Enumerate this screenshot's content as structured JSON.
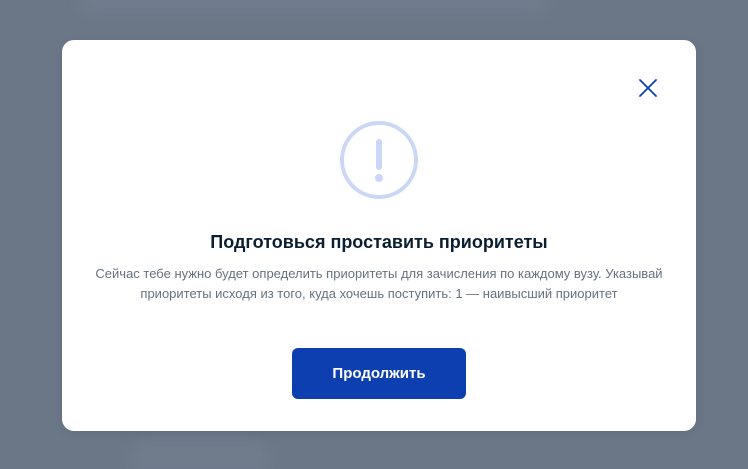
{
  "modal": {
    "title": "Подготовься проставить приоритеты",
    "message": "Сейчас тебе нужно будет определить приоритеты для зачисления по каждому вузу. Указывай приоритеты исходя из того, куда хочешь поступить: 1 — наивысший приоритет",
    "primary_button_label": "Продолжить",
    "icons": {
      "close": "close-icon",
      "warning": "warning-exclamation-icon"
    }
  },
  "colors": {
    "overlay": "#6b7787",
    "modal_background": "#ffffff",
    "accent": "#0d3fb1",
    "title_text": "#0b1f33",
    "body_text": "#66727f",
    "icon_tint": "#cbd8f5"
  }
}
